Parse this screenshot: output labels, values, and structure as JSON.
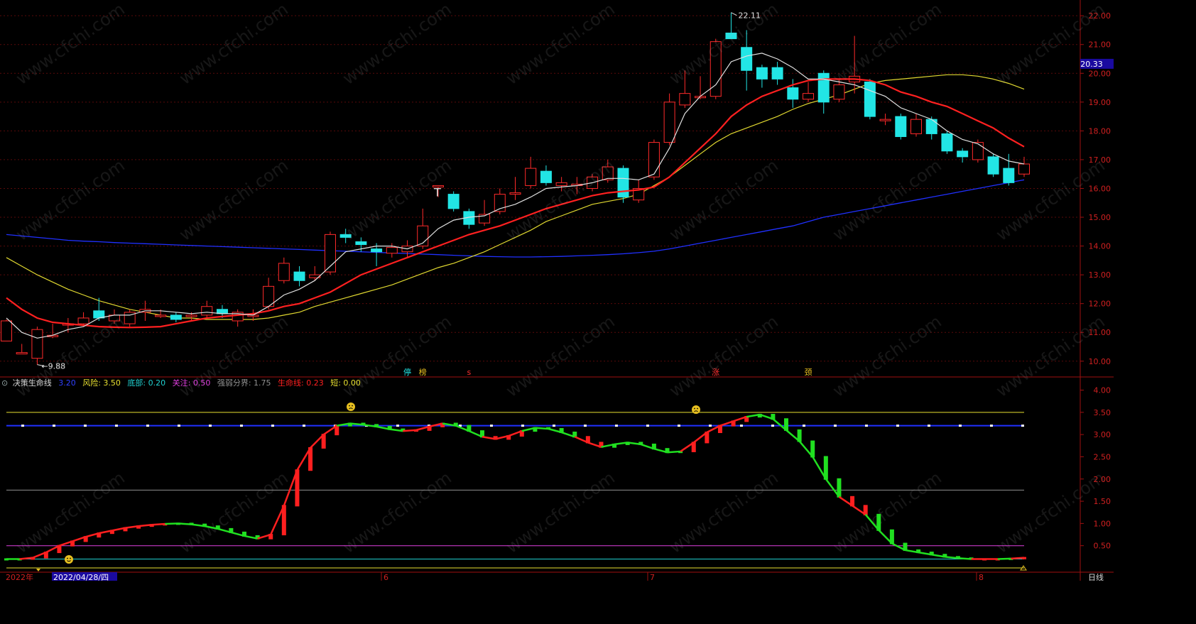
{
  "colors": {
    "up": "#ff2a2a",
    "down": "#22e5e5",
    "ma_short": "#e0e0e0",
    "ma_mid": "#ff2020",
    "ma_long": "#e0d830",
    "ma_vlong": "#2030ff",
    "axis": "#a01010",
    "grid": "#5a0a0a",
    "last_price_bg": "#1a0aa0",
    "line_up": "#ff1f1f",
    "line_down": "#20e020"
  },
  "price_axis": {
    "ticks": [
      "22.00",
      "21.00",
      "20.00",
      "19.00",
      "18.00",
      "17.00",
      "16.00",
      "15.00",
      "14.00",
      "13.00",
      "12.00",
      "11.00",
      "10.00"
    ],
    "last_price": "20.33"
  },
  "indicator_axis": {
    "ticks": [
      "4.00",
      "3.50",
      "3.00",
      "2.50",
      "2.00",
      "1.50",
      "1.00",
      "0.50"
    ]
  },
  "annotations": {
    "high": "22.11",
    "low": "9.88",
    "marks": [
      {
        "text": "停",
        "color": "#22e5e5"
      },
      {
        "text": "榜",
        "color": "#e8c020"
      },
      {
        "text": "s",
        "color": "#ff3030"
      },
      {
        "text": "涨",
        "color": "#ff3030"
      },
      {
        "text": "颈",
        "color": "#e8c020"
      }
    ]
  },
  "indicator_legend": {
    "name": "决策生命线",
    "items": [
      {
        "label": "风险: 3.50",
        "color": "#e8e030"
      },
      {
        "label": "底部: 0.20",
        "color": "#20d0d0"
      },
      {
        "label": "关注: 0.50",
        "color": "#e040e0"
      },
      {
        "label": "强弱分界: 1.75",
        "color": "#909090"
      },
      {
        "label": "生命线: 0.23",
        "color": "#ff2020"
      },
      {
        "label": "短: 0.00",
        "color": "#e8e030"
      }
    ],
    "partial_label": "3.20"
  },
  "bottom_bar": {
    "year": "2022年",
    "date": "2022/04/28/四",
    "months": [
      "6",
      "7",
      "8"
    ],
    "period": "日线"
  },
  "chart_data": [
    {
      "type": "candlestick",
      "title": "",
      "ylim": [
        9.6,
        22.3
      ],
      "candles": [
        {
          "o": 10.7,
          "c": 11.4,
          "h": 11.45,
          "l": 10.7
        },
        {
          "o": 10.3,
          "c": 10.3,
          "h": 10.6,
          "l": 10.25
        },
        {
          "o": 10.1,
          "c": 11.1,
          "h": 11.2,
          "l": 9.88
        },
        {
          "o": 10.9,
          "c": 10.9,
          "h": 11.3,
          "l": 10.8
        },
        {
          "o": 11.3,
          "c": 11.3,
          "h": 11.5,
          "l": 11.0
        },
        {
          "o": 11.3,
          "c": 11.5,
          "h": 11.7,
          "l": 11.2
        },
        {
          "o": 11.75,
          "c": 11.5,
          "h": 12.2,
          "l": 11.4
        },
        {
          "o": 11.4,
          "c": 11.6,
          "h": 11.8,
          "l": 11.3
        },
        {
          "o": 11.3,
          "c": 11.7,
          "h": 11.8,
          "l": 11.2
        },
        {
          "o": 11.7,
          "c": 11.8,
          "h": 12.1,
          "l": 11.4
        },
        {
          "o": 11.6,
          "c": 11.6,
          "h": 11.8,
          "l": 11.5
        },
        {
          "o": 11.6,
          "c": 11.45,
          "h": 11.7,
          "l": 11.35
        },
        {
          "o": 11.6,
          "c": 11.6,
          "h": 11.7,
          "l": 11.4
        },
        {
          "o": 11.6,
          "c": 11.9,
          "h": 12.1,
          "l": 11.5
        },
        {
          "o": 11.8,
          "c": 11.65,
          "h": 11.95,
          "l": 11.5
        },
        {
          "o": 11.4,
          "c": 11.7,
          "h": 11.8,
          "l": 11.2
        },
        {
          "o": 11.6,
          "c": 11.6,
          "h": 11.8,
          "l": 11.4
        },
        {
          "o": 11.9,
          "c": 12.6,
          "h": 12.9,
          "l": 11.8
        },
        {
          "o": 12.8,
          "c": 13.4,
          "h": 13.6,
          "l": 12.7
        },
        {
          "o": 13.1,
          "c": 12.8,
          "h": 13.3,
          "l": 12.6
        },
        {
          "o": 12.9,
          "c": 13.0,
          "h": 13.3,
          "l": 12.8
        },
        {
          "o": 13.1,
          "c": 14.4,
          "h": 14.5,
          "l": 13.0
        },
        {
          "o": 14.4,
          "c": 14.3,
          "h": 14.6,
          "l": 14.1
        },
        {
          "o": 14.15,
          "c": 14.05,
          "h": 14.3,
          "l": 13.8
        },
        {
          "o": 13.9,
          "c": 13.8,
          "h": 14.1,
          "l": 13.3
        },
        {
          "o": 13.75,
          "c": 13.95,
          "h": 14.1,
          "l": 13.6
        },
        {
          "o": 13.8,
          "c": 14.0,
          "h": 14.2,
          "l": 13.6
        },
        {
          "o": 14.0,
          "c": 14.7,
          "h": 15.3,
          "l": 13.9
        },
        {
          "o": 16.1,
          "c": 16.1,
          "h": 16.1,
          "l": 15.7
        },
        {
          "o": 15.8,
          "c": 15.3,
          "h": 15.9,
          "l": 15.2
        },
        {
          "o": 15.2,
          "c": 14.75,
          "h": 15.3,
          "l": 14.6
        },
        {
          "o": 14.8,
          "c": 15.1,
          "h": 15.6,
          "l": 14.7
        },
        {
          "o": 15.2,
          "c": 15.8,
          "h": 16.0,
          "l": 15.1
        },
        {
          "o": 15.8,
          "c": 15.85,
          "h": 16.4,
          "l": 15.6
        },
        {
          "o": 16.1,
          "c": 16.7,
          "h": 17.1,
          "l": 16.0
        },
        {
          "o": 16.6,
          "c": 16.2,
          "h": 16.8,
          "l": 16.1
        },
        {
          "o": 16.1,
          "c": 16.2,
          "h": 16.4,
          "l": 15.9
        },
        {
          "o": 16.1,
          "c": 16.15,
          "h": 16.4,
          "l": 15.8
        },
        {
          "o": 16.0,
          "c": 16.4,
          "h": 16.5,
          "l": 15.9
        },
        {
          "o": 16.3,
          "c": 16.75,
          "h": 17.0,
          "l": 16.2
        },
        {
          "o": 16.7,
          "c": 15.7,
          "h": 16.8,
          "l": 15.5
        },
        {
          "o": 15.6,
          "c": 16.0,
          "h": 16.3,
          "l": 15.5
        },
        {
          "o": 16.4,
          "c": 17.6,
          "h": 17.7,
          "l": 16.3
        },
        {
          "o": 17.6,
          "c": 19.0,
          "h": 19.3,
          "l": 17.5
        },
        {
          "o": 18.9,
          "c": 19.3,
          "h": 20.1,
          "l": 18.8
        },
        {
          "o": 19.2,
          "c": 19.2,
          "h": 19.9,
          "l": 19.1
        },
        {
          "o": 19.2,
          "c": 21.1,
          "h": 21.2,
          "l": 19.1
        },
        {
          "o": 21.4,
          "c": 21.2,
          "h": 22.11,
          "l": 21.2
        },
        {
          "o": 20.9,
          "c": 20.1,
          "h": 21.5,
          "l": 19.4
        },
        {
          "o": 20.2,
          "c": 19.8,
          "h": 20.3,
          "l": 19.5
        },
        {
          "o": 20.2,
          "c": 19.8,
          "h": 20.4,
          "l": 19.6
        },
        {
          "o": 19.5,
          "c": 19.1,
          "h": 19.8,
          "l": 18.8
        },
        {
          "o": 19.1,
          "c": 19.3,
          "h": 19.7,
          "l": 19.0
        },
        {
          "o": 20.0,
          "c": 19.0,
          "h": 20.1,
          "l": 18.6
        },
        {
          "o": 19.1,
          "c": 19.6,
          "h": 19.8,
          "l": 19.0
        },
        {
          "o": 19.7,
          "c": 19.9,
          "h": 21.3,
          "l": 19.3
        },
        {
          "o": 19.7,
          "c": 18.5,
          "h": 19.8,
          "l": 18.4
        },
        {
          "o": 18.4,
          "c": 18.4,
          "h": 18.6,
          "l": 18.2
        },
        {
          "o": 18.5,
          "c": 17.8,
          "h": 18.6,
          "l": 17.7
        },
        {
          "o": 17.9,
          "c": 18.4,
          "h": 18.6,
          "l": 17.8
        },
        {
          "o": 18.4,
          "c": 17.9,
          "h": 18.5,
          "l": 17.7
        },
        {
          "o": 17.9,
          "c": 17.3,
          "h": 18.0,
          "l": 17.2
        },
        {
          "o": 17.3,
          "c": 17.1,
          "h": 17.4,
          "l": 16.9
        },
        {
          "o": 17.0,
          "c": 17.6,
          "h": 17.7,
          "l": 16.9
        },
        {
          "o": 17.1,
          "c": 16.5,
          "h": 17.2,
          "l": 16.4
        },
        {
          "o": 16.7,
          "c": 16.2,
          "h": 17.2,
          "l": 16.1
        },
        {
          "o": 16.5,
          "c": 16.85,
          "h": 17.1,
          "l": 16.4
        }
      ],
      "ma_short": [
        11.5,
        11.0,
        10.8,
        10.9,
        11.1,
        11.2,
        11.5,
        11.6,
        11.6,
        11.75,
        11.75,
        11.7,
        11.65,
        11.7,
        11.65,
        11.65,
        11.6,
        11.9,
        12.3,
        12.5,
        12.8,
        13.3,
        13.8,
        13.9,
        14.0,
        14.0,
        13.9,
        14.1,
        14.6,
        14.9,
        15.0,
        15.05,
        15.3,
        15.45,
        15.7,
        16.0,
        16.05,
        16.1,
        16.2,
        16.35,
        16.35,
        16.3,
        16.5,
        17.4,
        18.6,
        19.2,
        19.6,
        20.4,
        20.6,
        20.7,
        20.5,
        20.2,
        19.8,
        19.8,
        19.7,
        19.6,
        19.4,
        19.2,
        18.8,
        18.6,
        18.4,
        18.0,
        17.7,
        17.55,
        17.2,
        16.95,
        16.85
      ],
      "ma_mid": [
        12.2,
        11.8,
        11.5,
        11.35,
        11.3,
        11.25,
        11.2,
        11.18,
        11.17,
        11.18,
        11.2,
        11.3,
        11.4,
        11.5,
        11.55,
        11.6,
        11.65,
        11.75,
        11.9,
        12.0,
        12.2,
        12.4,
        12.7,
        13.0,
        13.2,
        13.4,
        13.6,
        13.8,
        14.0,
        14.2,
        14.4,
        14.55,
        14.7,
        14.9,
        15.1,
        15.3,
        15.45,
        15.6,
        15.75,
        15.85,
        15.9,
        15.95,
        16.05,
        16.4,
        16.9,
        17.4,
        17.9,
        18.5,
        18.9,
        19.2,
        19.4,
        19.6,
        19.75,
        19.8,
        19.8,
        19.8,
        19.75,
        19.6,
        19.35,
        19.2,
        19.0,
        18.85,
        18.6,
        18.35,
        18.1,
        17.75,
        17.45
      ],
      "ma_long": [
        13.6,
        13.3,
        13.0,
        12.75,
        12.5,
        12.3,
        12.1,
        11.95,
        11.8,
        11.7,
        11.6,
        11.5,
        11.5,
        11.45,
        11.45,
        11.45,
        11.45,
        11.5,
        11.6,
        11.7,
        11.9,
        12.05,
        12.2,
        12.35,
        12.5,
        12.65,
        12.85,
        13.05,
        13.25,
        13.4,
        13.6,
        13.8,
        14.05,
        14.3,
        14.55,
        14.85,
        15.05,
        15.25,
        15.45,
        15.55,
        15.65,
        15.8,
        16.1,
        16.4,
        16.8,
        17.2,
        17.6,
        17.9,
        18.1,
        18.3,
        18.5,
        18.75,
        18.95,
        19.1,
        19.25,
        19.45,
        19.65,
        19.75,
        19.8,
        19.85,
        19.9,
        19.95,
        19.95,
        19.9,
        19.8,
        19.65,
        19.45
      ],
      "ma_vlong": [
        14.4,
        14.35,
        14.3,
        14.25,
        14.2,
        14.17,
        14.15,
        14.12,
        14.1,
        14.08,
        14.06,
        14.04,
        14.02,
        14.0,
        13.98,
        13.96,
        13.94,
        13.92,
        13.9,
        13.88,
        13.86,
        13.84,
        13.82,
        13.8,
        13.78,
        13.76,
        13.74,
        13.72,
        13.7,
        13.68,
        13.66,
        13.64,
        13.63,
        13.62,
        13.62,
        13.63,
        13.64,
        13.66,
        13.68,
        13.7,
        13.73,
        13.77,
        13.82,
        13.9,
        14.0,
        14.1,
        14.2,
        14.3,
        14.4,
        14.5,
        14.6,
        14.7,
        14.85,
        15.0,
        15.1,
        15.2,
        15.3,
        15.4,
        15.5,
        15.6,
        15.7,
        15.8,
        15.9,
        16.0,
        16.1,
        16.2,
        16.3
      ]
    },
    {
      "type": "line",
      "title": "决策生命线",
      "ylim": [
        0,
        4.2
      ],
      "levels": {
        "risk": 3.5,
        "blue": 3.2,
        "strong_weak": 1.75,
        "focus": 0.5,
        "bottom": 0.2,
        "short": 0.0
      },
      "values": [
        0.2,
        0.2,
        0.23,
        0.35,
        0.5,
        0.6,
        0.7,
        0.78,
        0.84,
        0.9,
        0.94,
        0.97,
        0.99,
        1.0,
        0.98,
        0.94,
        0.88,
        0.8,
        0.72,
        0.66,
        0.75,
        1.4,
        2.2,
        2.7,
        3.0,
        3.2,
        3.25,
        3.22,
        3.18,
        3.12,
        3.08,
        3.1,
        3.18,
        3.25,
        3.2,
        3.08,
        2.95,
        2.9,
        2.97,
        3.08,
        3.15,
        3.13,
        3.05,
        2.95,
        2.82,
        2.72,
        2.78,
        2.82,
        2.78,
        2.68,
        2.6,
        2.62,
        2.82,
        3.05,
        3.2,
        3.3,
        3.4,
        3.45,
        3.35,
        3.1,
        2.85,
        2.5,
        2.0,
        1.6,
        1.4,
        1.2,
        0.85,
        0.55,
        0.4,
        0.35,
        0.3,
        0.25,
        0.22,
        0.2,
        0.2,
        0.2,
        0.21,
        0.23
      ],
      "up": [
        false,
        false,
        true,
        true,
        true,
        true,
        true,
        true,
        true,
        true,
        true,
        true,
        true,
        false,
        false,
        false,
        false,
        false,
        false,
        false,
        true,
        true,
        true,
        true,
        true,
        true,
        false,
        false,
        false,
        false,
        false,
        true,
        true,
        true,
        false,
        false,
        false,
        true,
        true,
        true,
        false,
        false,
        false,
        false,
        true,
        true,
        false,
        false,
        false,
        false,
        false,
        false,
        true,
        true,
        true,
        true,
        true,
        false,
        false,
        false,
        false,
        false,
        false,
        false,
        true,
        true,
        false,
        false,
        false,
        false,
        false,
        false,
        false,
        false,
        true,
        true,
        false,
        true
      ]
    }
  ]
}
